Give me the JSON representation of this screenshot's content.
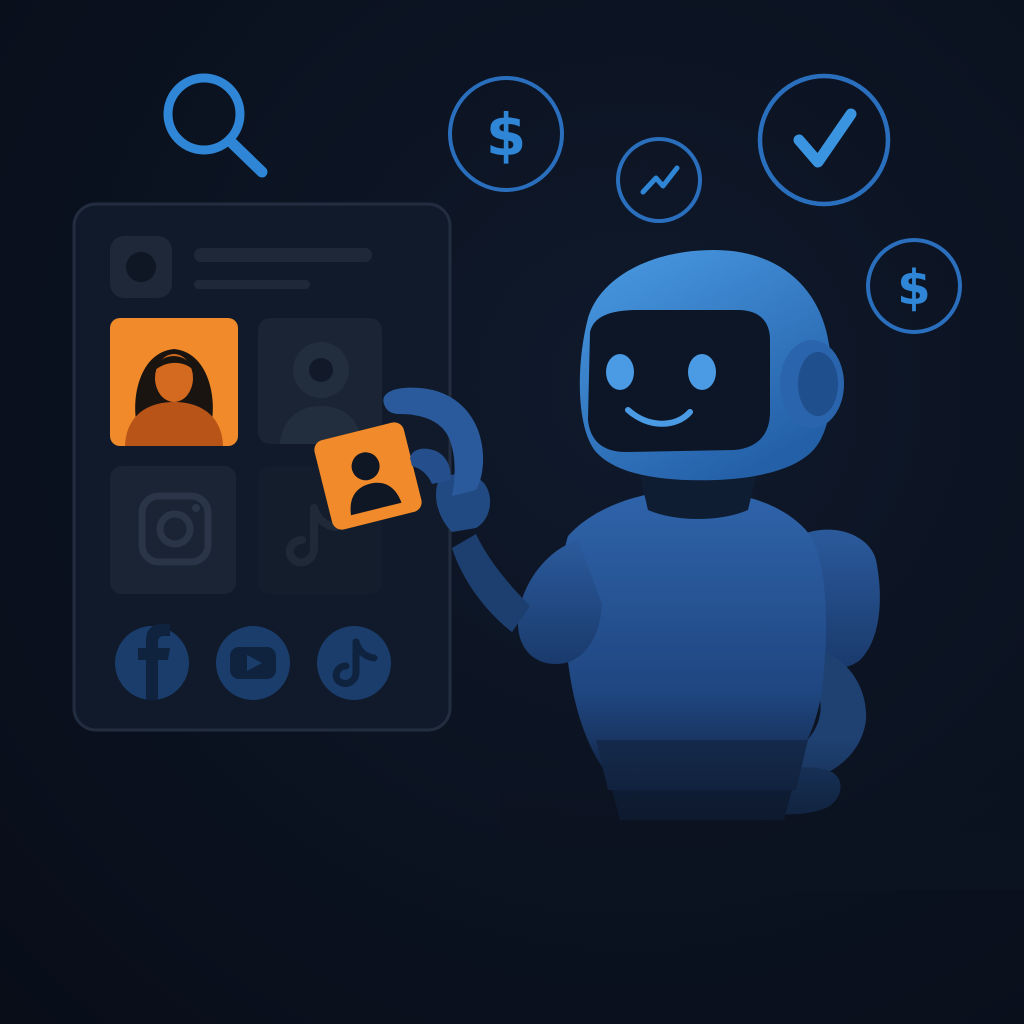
{
  "illustration": {
    "floating_icons": [
      {
        "name": "search-icon"
      },
      {
        "name": "dollar-coin-icon",
        "symbol": "$"
      },
      {
        "name": "trend-check-icon"
      },
      {
        "name": "checkmark-circle-icon"
      },
      {
        "name": "dollar-coin-icon",
        "symbol": "$"
      }
    ],
    "profile_panel": {
      "header": {
        "avatar": "app-icon",
        "text_lines": 2
      },
      "tiles": [
        {
          "name": "profile-tile-woman",
          "icon": "woman-avatar-icon",
          "selected": true
        },
        {
          "name": "profile-tile-person",
          "icon": "person-avatar-icon",
          "selected": false
        },
        {
          "name": "profile-tile-instagram",
          "icon": "instagram-icon",
          "selected": false
        },
        {
          "name": "profile-tile-tiktok",
          "icon": "tiktok-icon",
          "selected": false
        }
      ],
      "social_buttons": [
        {
          "name": "facebook-button",
          "icon": "facebook-icon"
        },
        {
          "name": "youtube-button",
          "icon": "youtube-icon"
        },
        {
          "name": "tiktok-button",
          "icon": "tiktok-icon"
        }
      ]
    },
    "held_card": {
      "icon": "person-avatar-icon"
    },
    "robot": {
      "expression": "smiling"
    },
    "colors": {
      "background": "#0b1220",
      "panel": "#121b2b",
      "panel_border": "#222d40",
      "tile": "#1b2536",
      "accent_blue": "#2f86d6",
      "robot_blue": "#2a62a8",
      "highlight_orange": "#f08a2a"
    }
  }
}
